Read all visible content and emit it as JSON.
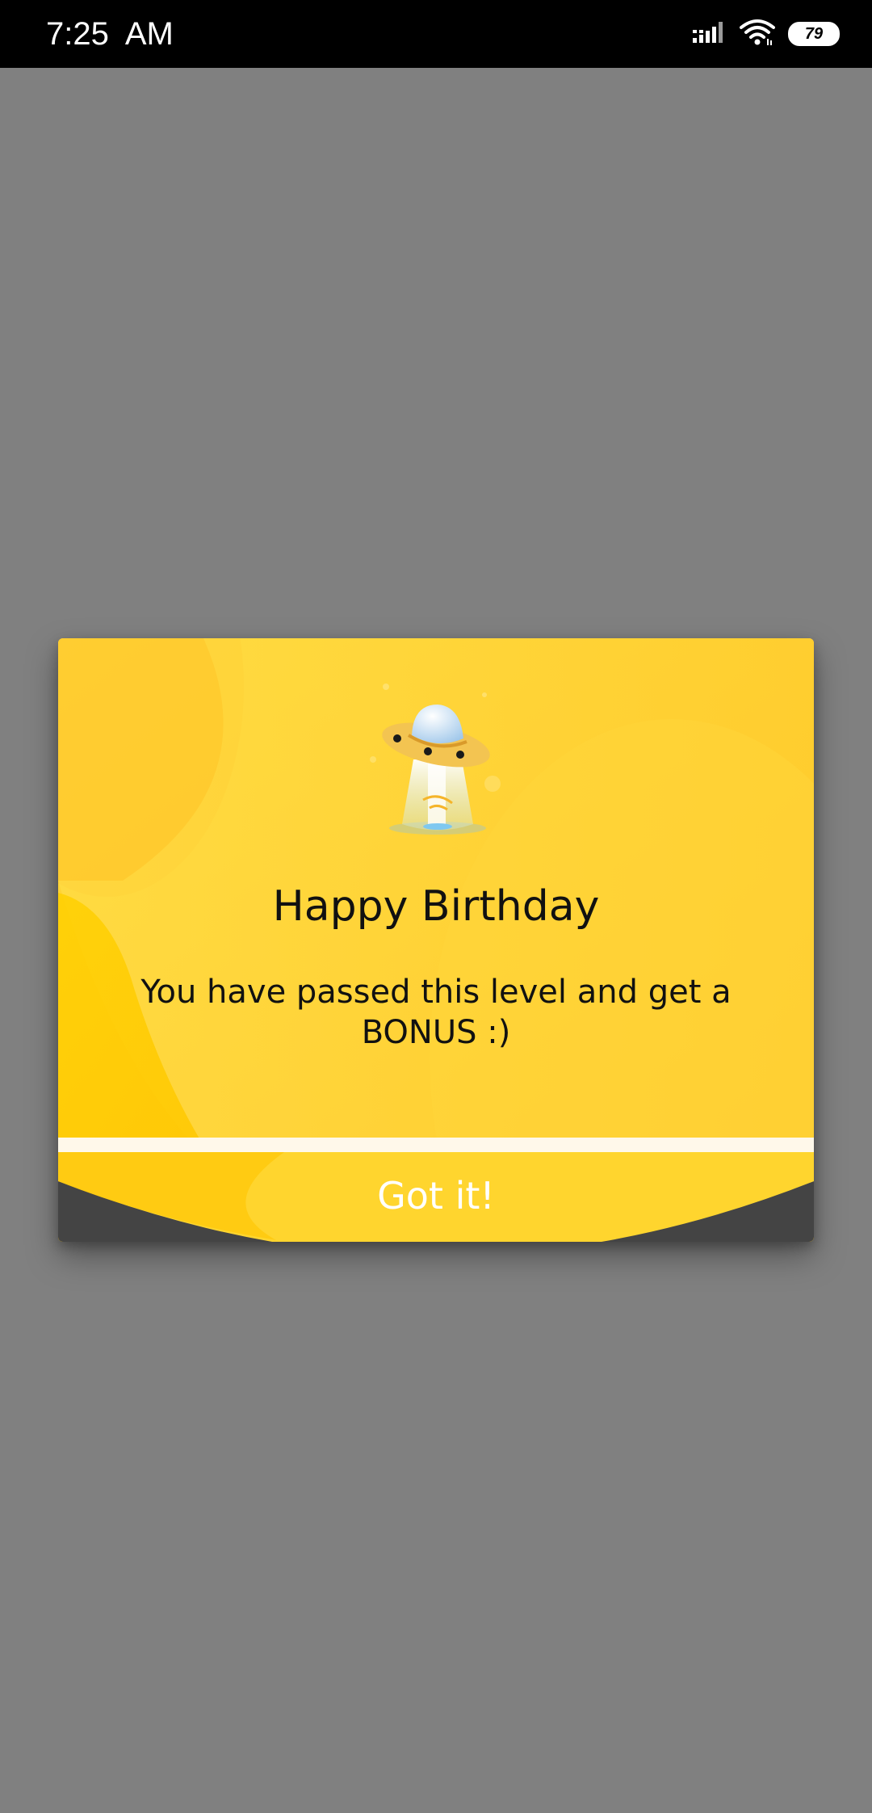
{
  "status_bar": {
    "time": "7:25  AM",
    "battery_level": "79",
    "icons": [
      "signal-icon",
      "wifi-icon",
      "battery-icon"
    ]
  },
  "dialog": {
    "title": "Happy Birthday",
    "message": "You have passed this level and get a BONUS :)",
    "button_label": "Got it!",
    "illustration": "ufo-icon",
    "colors": {
      "background": "#ffcc2a",
      "accent_light": "#ffdf40",
      "footer_dark": "#444444",
      "divider": "#fff8ea",
      "overlay": "#808080"
    }
  }
}
